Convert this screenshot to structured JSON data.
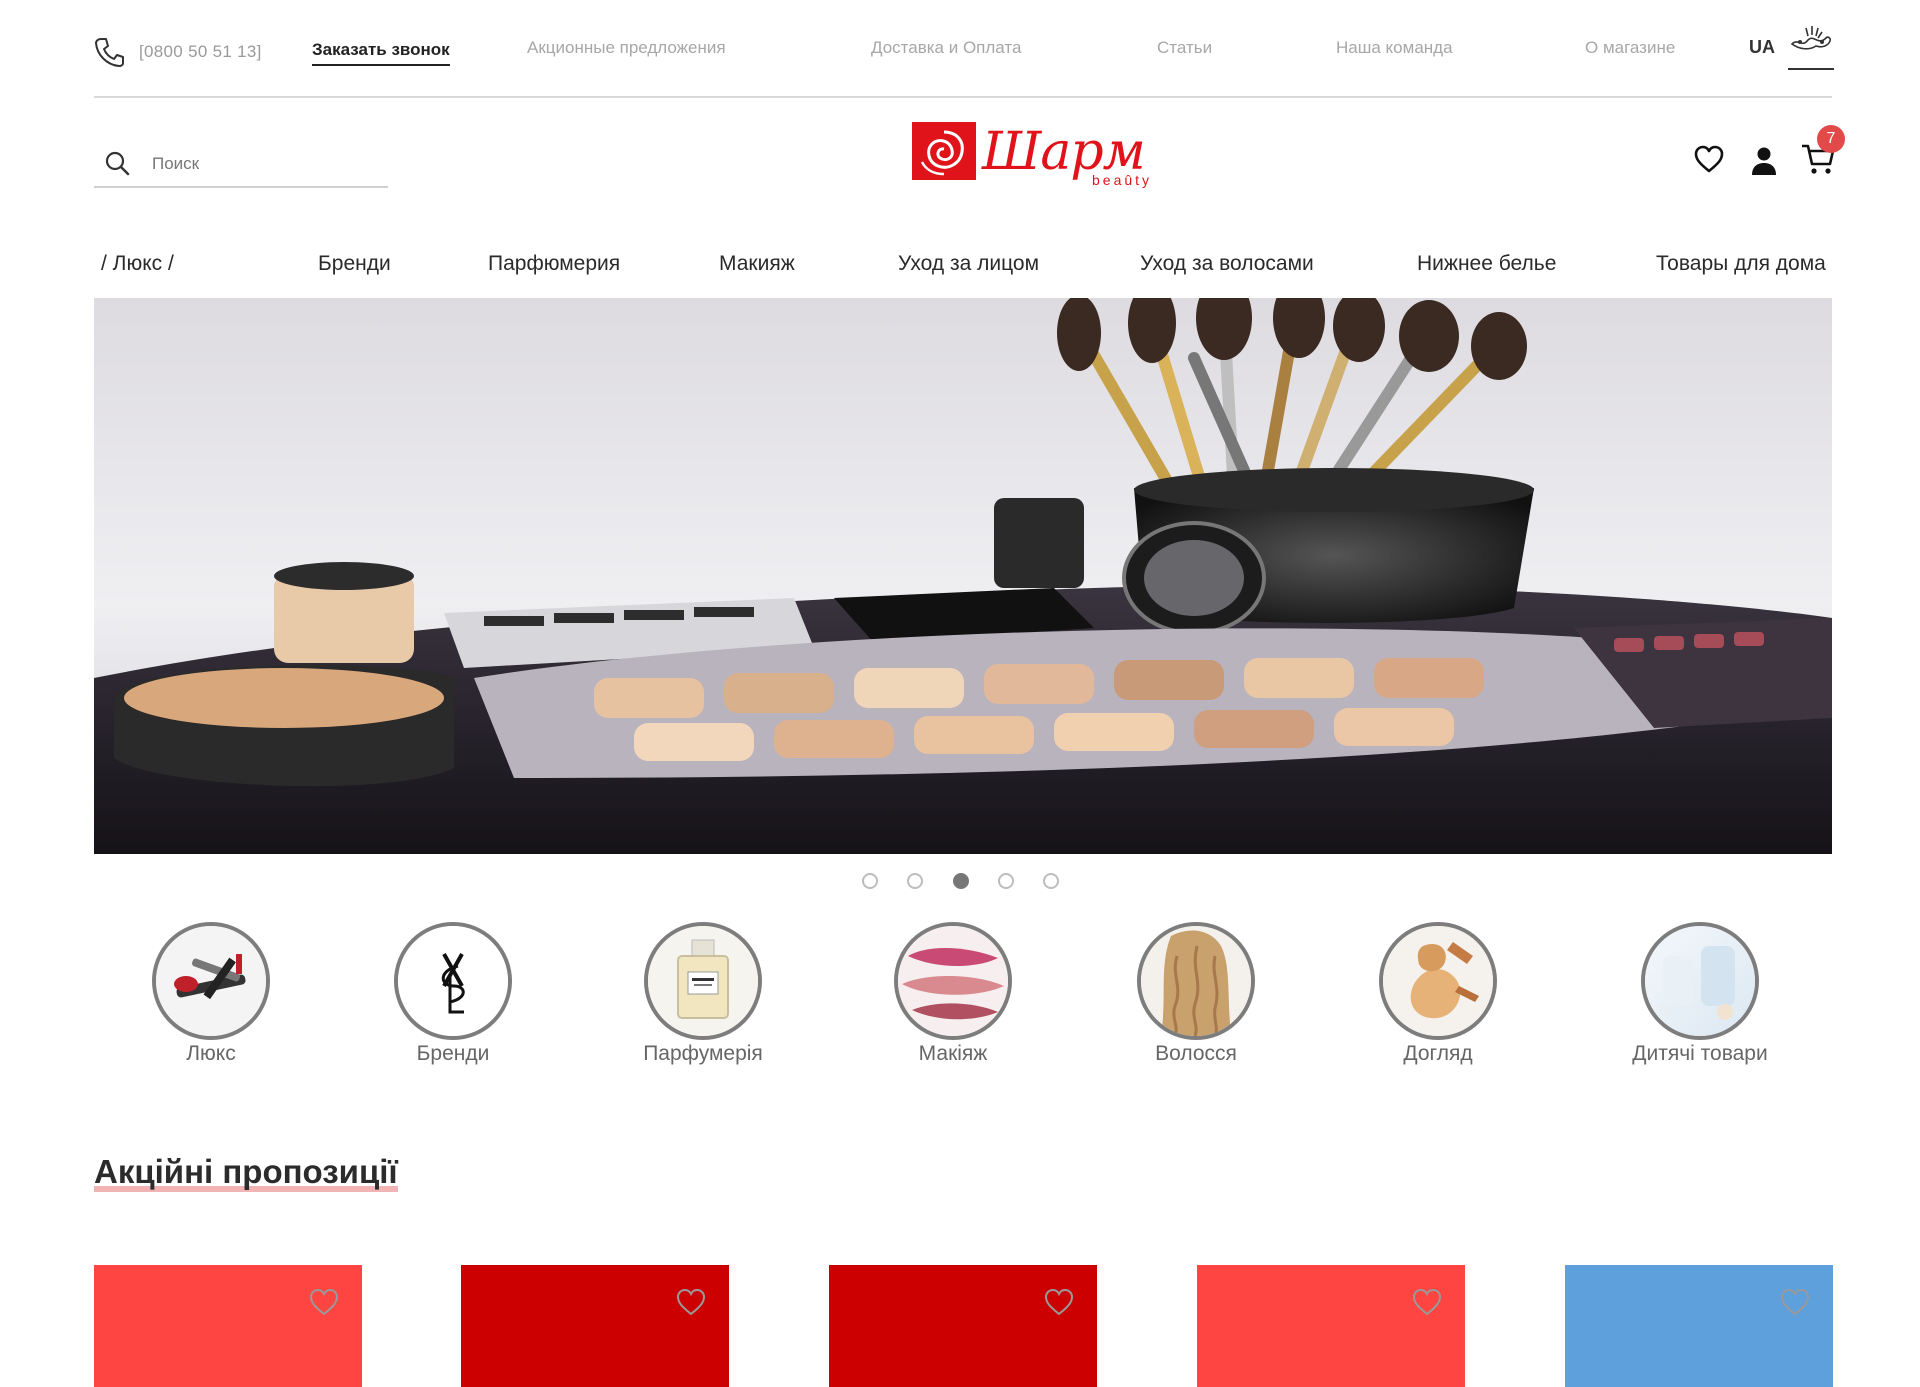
{
  "topbar": {
    "phone": "[0800 50 51 13]",
    "callback_label": "Заказать звонок",
    "links": [
      "Акционные предложения",
      "Доставка и Оплата",
      "Статьи",
      "Наша команда",
      "О магазине"
    ],
    "lang": "UA"
  },
  "header": {
    "search_placeholder": "Поиск",
    "logo_text": "Шарм",
    "logo_sub": "beaûty",
    "cart_count": "7"
  },
  "nav": {
    "items": [
      "/  Люкс  /",
      "Бренди",
      "Парфюмерия",
      "Макияж",
      "Уход за лицом",
      "Уход за волосами",
      "Нижнее белье",
      "Товары для дома"
    ]
  },
  "carousel": {
    "slide_count": 5,
    "active_index": 2
  },
  "categories": {
    "items": [
      "Люкс",
      "Бренди",
      "Парфумерія",
      "Макіяж",
      "Волосся",
      "Догляд",
      "Дитячі товари"
    ]
  },
  "promos": {
    "title": "Акційні пропозиції",
    "card_colors": [
      "#fe4542",
      "#cc0000",
      "#cc0000",
      "#fe4542",
      "#5ea0dc"
    ]
  },
  "colors": {
    "brand": "#e0131b",
    "badge": "#e24a4a"
  }
}
